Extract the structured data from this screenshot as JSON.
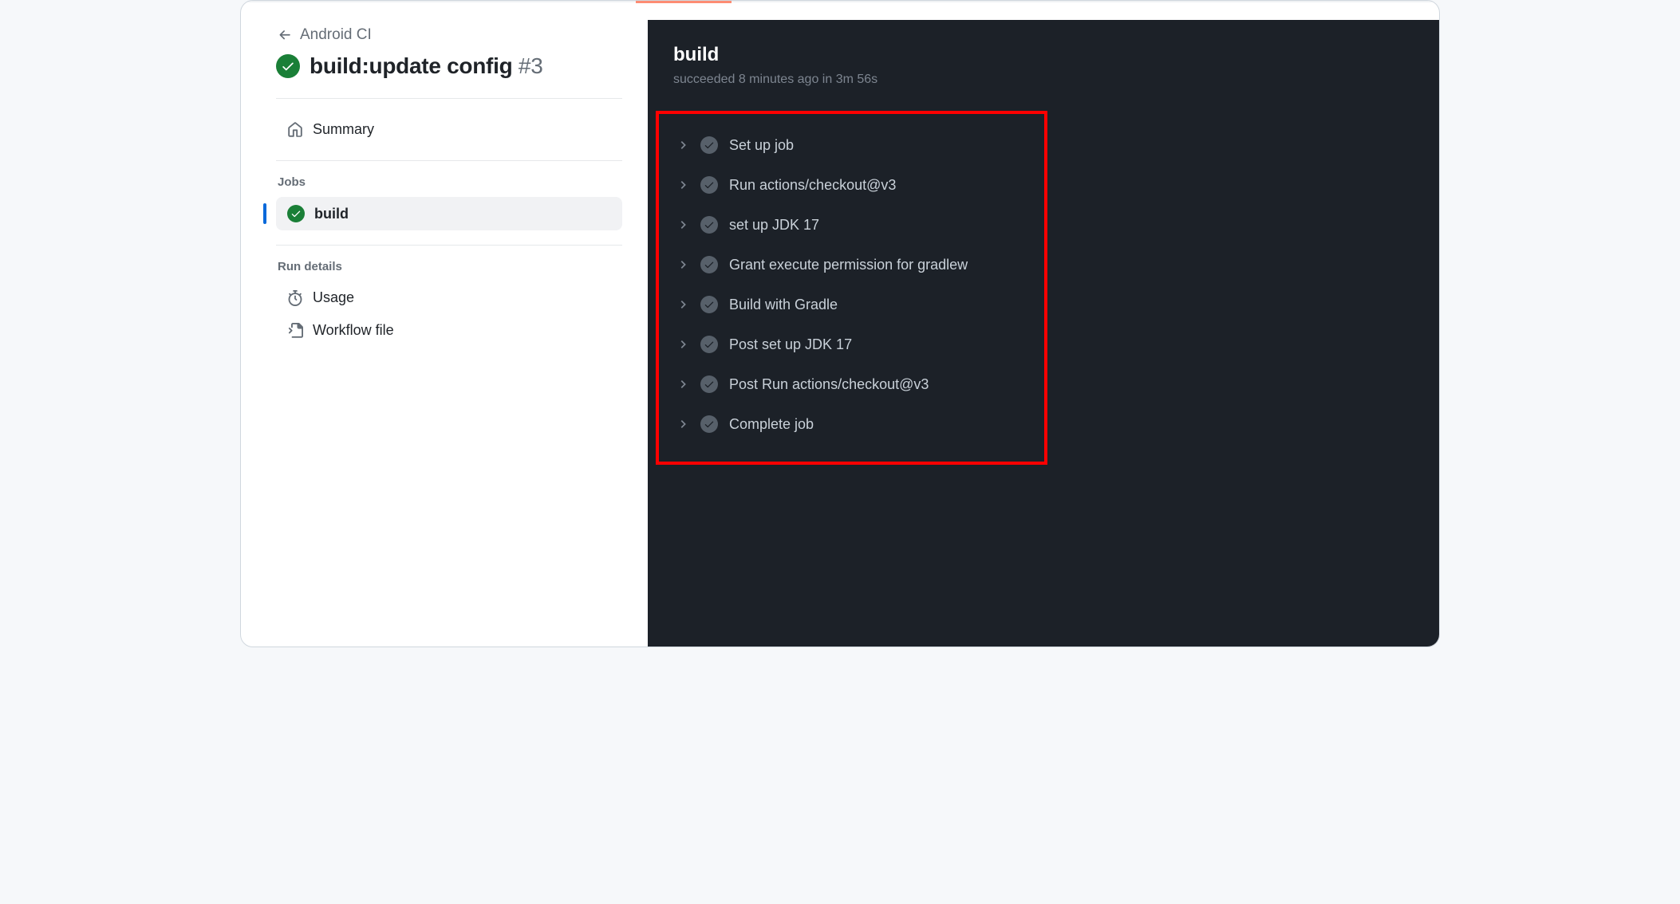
{
  "breadcrumb": {
    "back_label": "Android CI"
  },
  "run": {
    "title_prefix": "build:update config ",
    "run_number": "#3"
  },
  "sidebar": {
    "summary_label": "Summary",
    "jobs_heading": "Jobs",
    "jobs": [
      {
        "label": "build"
      }
    ],
    "run_details_heading": "Run details",
    "usage_label": "Usage",
    "workflow_file_label": "Workflow file"
  },
  "panel": {
    "title": "build",
    "subtitle": "succeeded 8 minutes ago in 3m 56s",
    "steps": [
      {
        "label": "Set up job"
      },
      {
        "label": "Run actions/checkout@v3"
      },
      {
        "label": "set up JDK 17"
      },
      {
        "label": "Grant execute permission for gradlew"
      },
      {
        "label": "Build with Gradle"
      },
      {
        "label": "Post set up JDK 17"
      },
      {
        "label": "Post Run actions/checkout@v3"
      },
      {
        "label": "Complete job"
      }
    ]
  }
}
